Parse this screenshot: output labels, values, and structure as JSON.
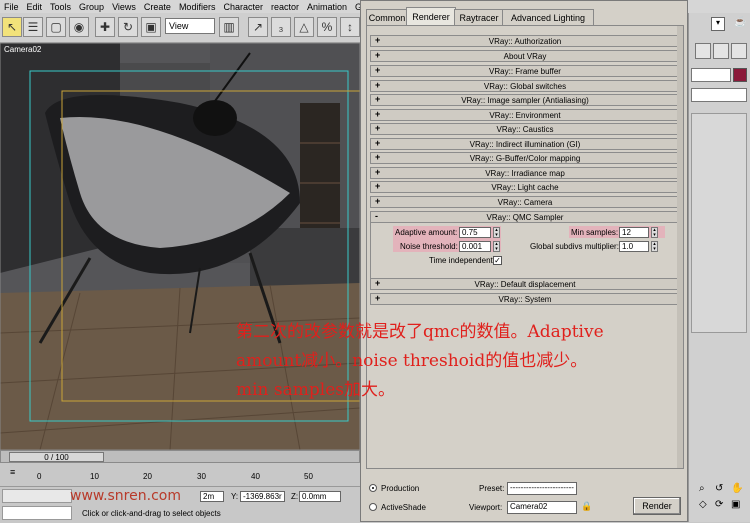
{
  "menu": [
    "File",
    "Edit",
    "Tools",
    "Group",
    "Views",
    "Create",
    "Modifiers",
    "Character",
    "reactor",
    "Animation",
    "Graph Ed"
  ],
  "toolbar": {
    "view_dropdown": "View"
  },
  "viewport": {
    "label": "Camera02"
  },
  "timeline": {
    "frame_counter": "0 / 100",
    "ticks": [
      "0",
      "10",
      "20",
      "30",
      "40",
      "50"
    ],
    "y_label": "Y:",
    "y_value": "-1369.863r",
    "z_label": "Z:",
    "z_value": "0.0mm",
    "x_value_partial": "2m",
    "status_text": "Click or click-and-drag to select objects",
    "watermark": "www.snren.com"
  },
  "dialog": {
    "tabs": [
      "Common",
      "Renderer",
      "Raytracer",
      "Advanced Lighting"
    ],
    "rollouts_top": [
      "VRay:: Authorization",
      "About VRay",
      "VRay:: Frame buffer",
      "VRay:: Global switches",
      "VRay:: Image sampler (Antialiasing)",
      "VRay:: Environment",
      "VRay:: Caustics",
      "VRay:: Indirect illumination (GI)",
      "VRay:: G-Buffer/Color mapping",
      "VRay:: Irradiance map",
      "VRay:: Light cache",
      "VRay:: Camera"
    ],
    "qmc": {
      "title": "VRay:: QMC Sampler",
      "adaptive_amount_label": "Adaptive amount:",
      "adaptive_amount_value": "0.75",
      "noise_threshold_label": "Noise threshold:",
      "noise_threshold_value": "0.001",
      "time_independent_label": "Time independent",
      "min_samples_label": "Min samples:",
      "min_samples_value": "12",
      "global_subdivs_label": "Global subdivs multiplier:",
      "global_subdivs_value": "1.0"
    },
    "rollouts_bottom": [
      "VRay:: Default displacement",
      "VRay:: System"
    ],
    "production_label": "Production",
    "activeshade_label": "ActiveShade",
    "preset_label": "Preset:",
    "preset_value": "------------------------",
    "viewport_label": "Viewport:",
    "viewport_value": "Camera02",
    "render_button": "Render"
  },
  "annotation": {
    "line1": "第二次的改参数就是改了qmc的数值。Adaptive",
    "line2": "amount减小。noise threshoid的值也减少。",
    "line3": "min samples加大。"
  },
  "colors": {
    "highlight": "#e3b3bb",
    "annotation": "#e0201c",
    "active_tool": "#f2e27a"
  }
}
